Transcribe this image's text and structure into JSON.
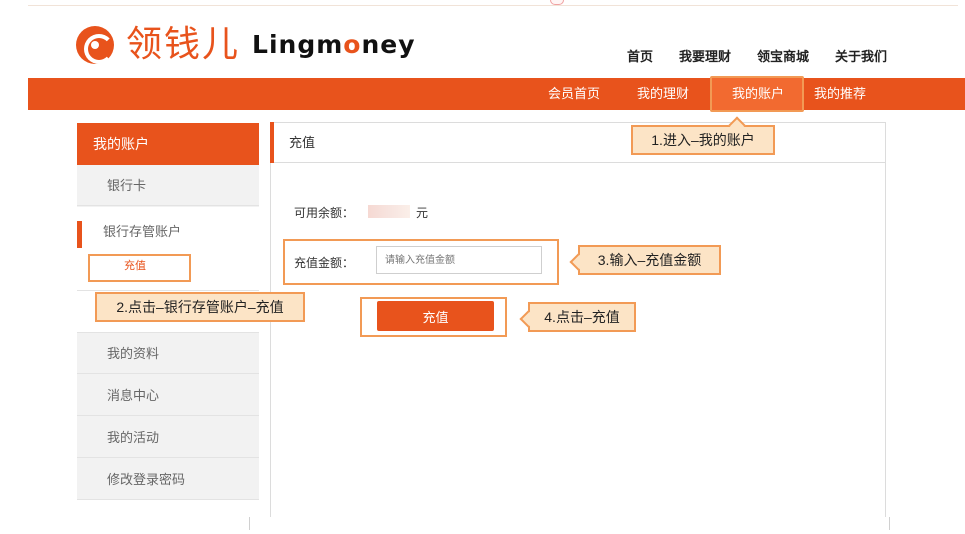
{
  "brand": {
    "name_cn": "领钱儿",
    "name_en_prefix": "Lingm",
    "name_en_o": "o",
    "name_en_suffix": "ney",
    "accent": "#e8531c"
  },
  "top_nav": [
    "首页",
    "我要理财",
    "领宝商城",
    "关于我们"
  ],
  "sub_nav": [
    "会员首页",
    "我的理财",
    "我的账户",
    "我的推荐"
  ],
  "sidebar": {
    "title": "我的账户",
    "items": [
      "银行卡",
      "银行存管账户",
      "充值",
      "我的资料",
      "消息中心",
      "我的活动",
      "修改登录密码"
    ]
  },
  "panel": {
    "title": "充值",
    "balance_label": "可用余额：",
    "balance_unit": "元",
    "amount_label": "充值金额：",
    "amount_placeholder": "请输入充值金额",
    "submit_label": "充值"
  },
  "callouts": {
    "step1": "1.进入–我的账户",
    "step2": "2.点击–银行存管账户–充值",
    "step3": "3.输入–充值金额",
    "step4": "4.点击–充值"
  }
}
